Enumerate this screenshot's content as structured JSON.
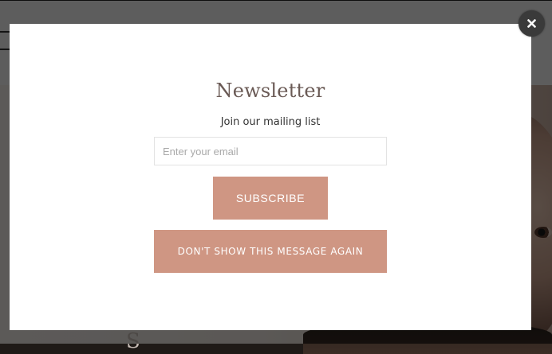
{
  "modal": {
    "title": "Newsletter",
    "subtitle": "Join our mailing list",
    "email_placeholder": "Enter your email",
    "email_value": "",
    "subscribe_label": "SUBSCRIBE",
    "dont_show_label": "DON'T SHOW THIS MESSAGE AGAIN",
    "close_icon": "close-icon"
  },
  "colors": {
    "button_bg": "#cf9683",
    "button_text": "#ffffff",
    "title_text": "#6a5a55",
    "overlay": "rgba(0,0,0,0.62)"
  }
}
